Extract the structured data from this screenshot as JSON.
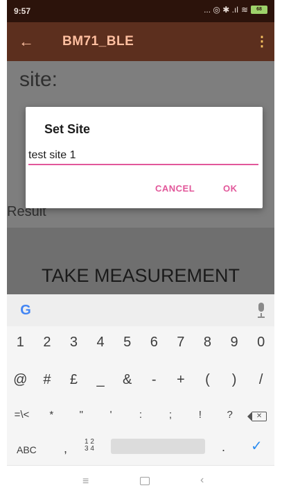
{
  "status_bar": {
    "time": "9:57",
    "indicators": "... ◎ ✱ .ıl",
    "battery": "68"
  },
  "app_bar": {
    "title": "BM71_BLE"
  },
  "content": {
    "site_label": "site:",
    "result_label": "Result",
    "take_measurement": "TAKE MEASUREMENT"
  },
  "dialog": {
    "title": "Set Site",
    "input_value": "test site 1",
    "cancel_label": "CANCEL",
    "ok_label": "OK"
  },
  "keyboard": {
    "numbers": [
      "1",
      "2",
      "3",
      "4",
      "5",
      "6",
      "7",
      "8",
      "9",
      "0"
    ],
    "symbols": [
      "@",
      "#",
      "£",
      "_",
      "&",
      "-",
      "+",
      "(",
      ")",
      "/"
    ],
    "symbols2": [
      "=\\<",
      "*",
      "\"",
      "'",
      ":",
      ";",
      "!",
      "?"
    ],
    "abc": "ABC",
    "comma": ",",
    "num_top": "1 2",
    "num_bottom": "3 4",
    "period": ".",
    "google_letter": "G"
  },
  "colors": {
    "accent": "#e2579a",
    "appbar": "#5c2f1e",
    "status": "#2c130b"
  }
}
